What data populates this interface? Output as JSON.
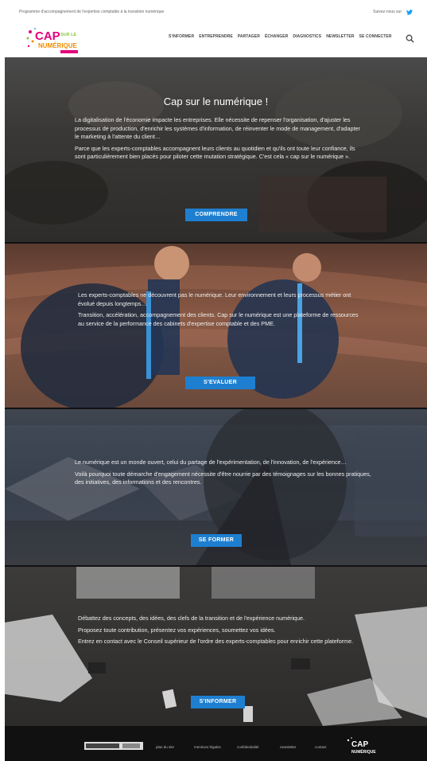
{
  "topbar": {
    "tagline": "Programme d'accompagnement de l'expertise comptable à la transition numérique",
    "follow_label": "Suivez-nous sur"
  },
  "logo": {
    "line1": "CAP",
    "line2": "SUR LE",
    "line3": "NUMÉRIQUE"
  },
  "nav": {
    "items": [
      "S'INFORMER",
      "ENTREPRENDRE",
      "PARTAGER",
      "ÉCHANGER",
      "DIAGNOSTICS",
      "NEWSLETTER",
      "SE CONNECTER"
    ]
  },
  "sections": [
    {
      "title": "Cap sur le numérique !",
      "paragraphs": [
        "La digitalisation de l'économie impacte les entreprises. Elle nécessite de repenser l'organisation, d'ajuster les processus de production, d'enrichir les systèmes d'information, de réinventer le mode de management, d'adapter le marketing à l'attente du client…",
        "Parce que les experts-comptables accompagnent leurs clients au quotidien et qu'ils ont toute leur confiance, ils sont particulièrement bien placés pour piloter cette mutation stratégique. C'est cela « cap sur le numérique »."
      ],
      "button": "COMPRENDRE"
    },
    {
      "paragraphs": [
        "Les experts-comptables ne découvrent pas le numérique. Leur environnement et leurs processus métier ont évolué depuis longtemps…",
        "Transition, accélération, accompagnement des clients. Cap sur le numérique est une plateforme de ressources au service de la performance des cabinets d'expertise comptable et des PME."
      ],
      "button": "S'EVALUER"
    },
    {
      "paragraphs": [
        "Le numérique est un monde ouvert, celui du partage de l'expérimentation, de l'innovation, de l'expérience…",
        "Voilà pourquoi toute démarche d'engagement nécessite d'être nourrie par des témoignages sur les bonnes pratiques, des initiatives, des informations et des rencontres."
      ],
      "button": "SE FORMER"
    },
    {
      "paragraphs": [
        "Débattez des concepts, des idées, des clefs de la transition et de l'expérience numérique.",
        "Proposez toute contribution, présentez vos expériences, soumettez vos idées.",
        "Entrez en contact avec le Conseil supérieur de l'ordre des experts-comptables pour enrichir cette plateforme."
      ],
      "button": "S'INFORMER"
    }
  ],
  "footer": {
    "links": [
      "plan du site",
      "mentions légales",
      "confidentialité",
      "newsletter",
      "contact"
    ]
  },
  "colors": {
    "accent": "#1e7fd0",
    "logo_pink": "#e4007c",
    "logo_orange": "#f28c00",
    "logo_green": "#8cc63f"
  }
}
